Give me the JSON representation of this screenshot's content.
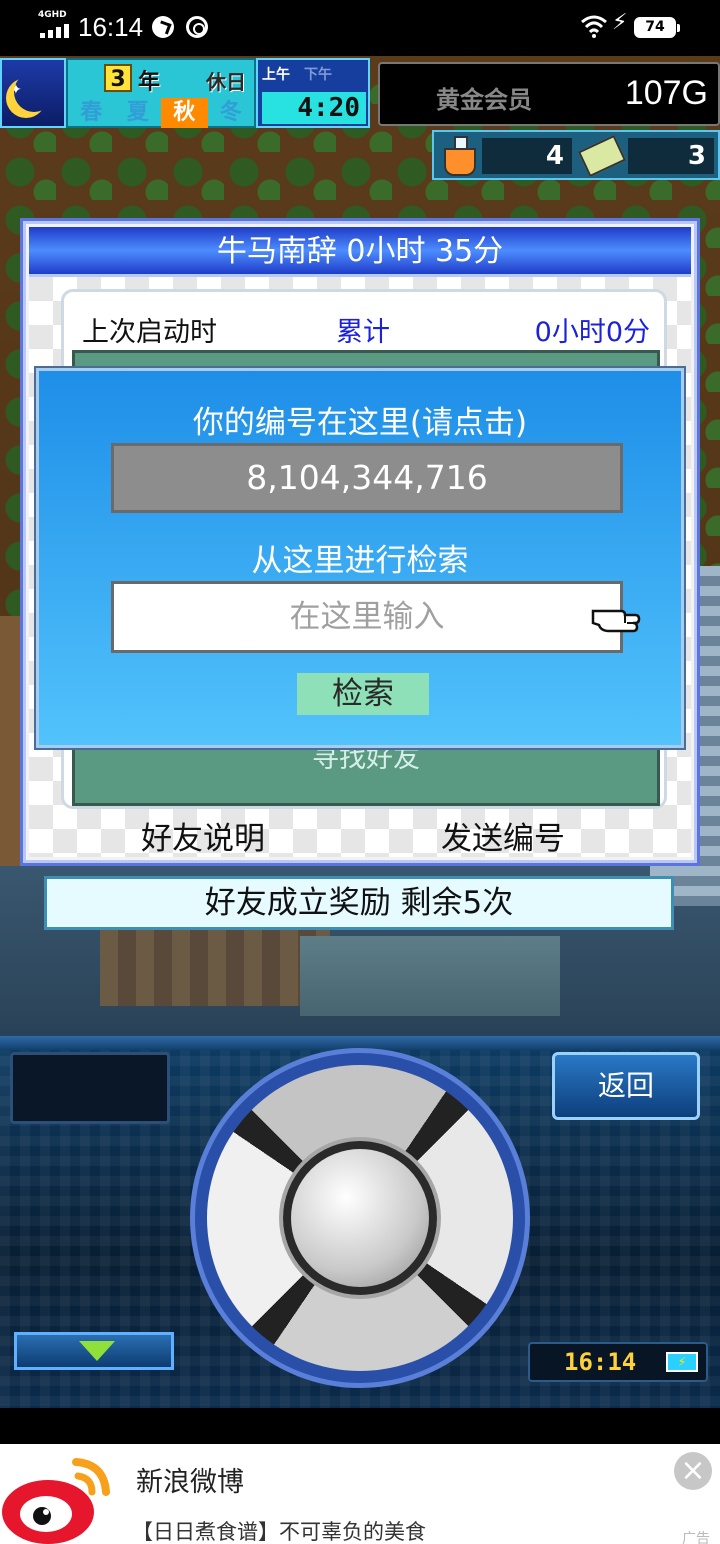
{
  "status_bar": {
    "network": "4GHD",
    "time": "16:14",
    "battery": "74"
  },
  "hud": {
    "year_number": "3",
    "year_label": "年",
    "holiday": "休日",
    "seasons": [
      "春",
      "夏",
      "秋",
      "冬"
    ],
    "active_season": "秋",
    "am_label": "上午",
    "pm_label": "下午",
    "clock": "4:20",
    "member_label": "黄金会员",
    "gold": "107G",
    "item1_count": "4",
    "item2_count": "3"
  },
  "friends_panel": {
    "title": "牛马南辞  0小时 35分",
    "last_launch_label": "上次启动时",
    "cumulative_label": "累计",
    "cumulative_value": "0小时0分",
    "find_friend_label": "寻找好友",
    "friend_explain_label": "好友说明",
    "send_number_label": "发送编号"
  },
  "bonus_bar": {
    "text": "好友成立奖励  剩余5次"
  },
  "search_dialog": {
    "your_id_label": "你的编号在这里(请点击)",
    "your_id_value": "8,104,344,716",
    "search_label": "从这里进行检索",
    "input_placeholder": "在这里输入",
    "search_button": "检索"
  },
  "controls": {
    "back_button": "返回",
    "mini_clock": "16:14"
  },
  "ad": {
    "title": "新浪微博",
    "description": "【日日煮食谱】不可辜负的美食",
    "tag": "广告",
    "close_label": "×"
  },
  "colors": {
    "dialog_blue": "#1e8ee8",
    "panel_title_blue": "#1f3cc8",
    "highlight_blue": "#1c22d8",
    "search_button_green": "#8ee0b8",
    "season_active_orange": "#ff8a00",
    "weibo_red": "#e6162d"
  }
}
